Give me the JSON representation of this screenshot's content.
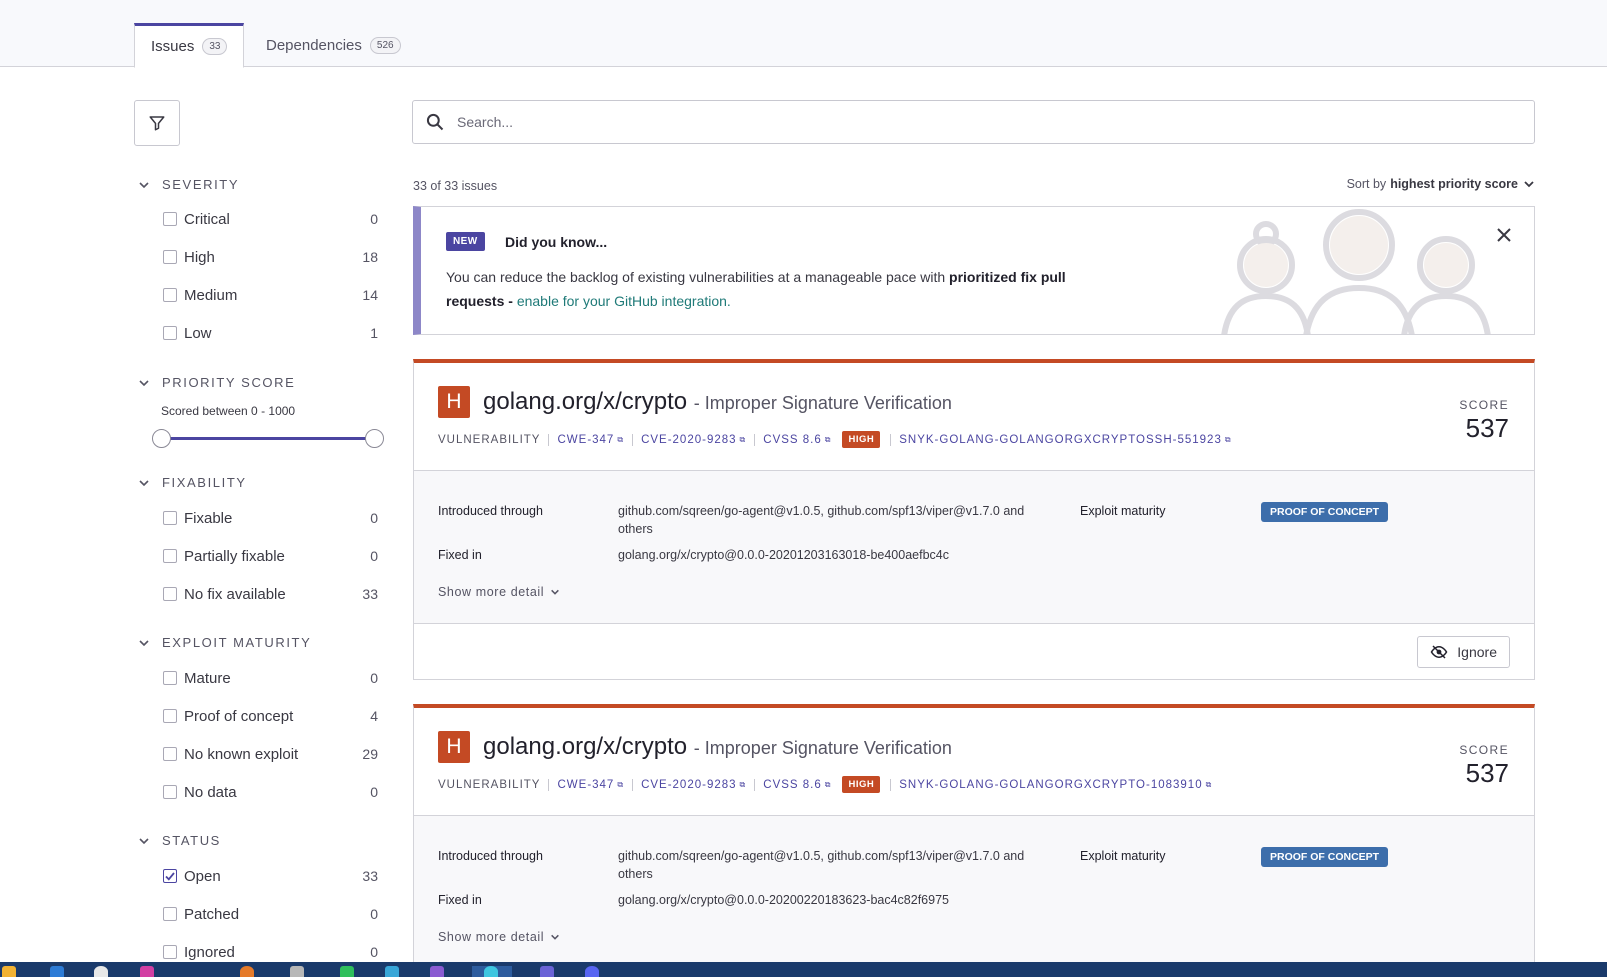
{
  "tabs": [
    {
      "label": "Issues",
      "count": "33"
    },
    {
      "label": "Dependencies",
      "count": "526"
    }
  ],
  "filters": {
    "severity": {
      "title": "SEVERITY",
      "items": [
        {
          "label": "Critical",
          "count": "0"
        },
        {
          "label": "High",
          "count": "18"
        },
        {
          "label": "Medium",
          "count": "14"
        },
        {
          "label": "Low",
          "count": "1"
        }
      ]
    },
    "priority": {
      "title": "PRIORITY SCORE",
      "range_label": "Scored between 0 - 1000",
      "range_min": 0,
      "range_max": 1000
    },
    "fixability": {
      "title": "FIXABILITY",
      "items": [
        {
          "label": "Fixable",
          "count": "0"
        },
        {
          "label": "Partially fixable",
          "count": "0"
        },
        {
          "label": "No fix available",
          "count": "33"
        }
      ]
    },
    "exploit": {
      "title": "EXPLOIT MATURITY",
      "items": [
        {
          "label": "Mature",
          "count": "0"
        },
        {
          "label": "Proof of concept",
          "count": "4"
        },
        {
          "label": "No known exploit",
          "count": "29"
        },
        {
          "label": "No data",
          "count": "0"
        }
      ]
    },
    "status": {
      "title": "STATUS",
      "items": [
        {
          "label": "Open",
          "count": "33",
          "checked": true
        },
        {
          "label": "Patched",
          "count": "0"
        },
        {
          "label": "Ignored",
          "count": "0"
        }
      ]
    }
  },
  "search": {
    "placeholder": "Search..."
  },
  "summary": "33 of 33 issues",
  "sort": {
    "prefix": "Sort by",
    "value": "highest priority score"
  },
  "banner": {
    "badge": "NEW",
    "title": "Did you know...",
    "text_before": "You can reduce the backlog of existing vulnerabilities at a manageable pace with ",
    "text_bold": "prioritized fix pull requests - ",
    "link": "enable for your GitHub integration."
  },
  "issues": [
    {
      "severity_letter": "H",
      "package": "golang.org/x/crypto",
      "title": "- Improper Signature Verification",
      "type": "VULNERABILITY",
      "cwe": "CWE-347",
      "cve": "CVE-2020-9283",
      "cvss": "CVSS 8.6",
      "severity": "HIGH",
      "snyk_id": "SNYK-GOLANG-GOLANGORGXCRYPTOSSH-551923",
      "score_label": "SCORE",
      "score": "537",
      "introduced_label": "Introduced through",
      "introduced": "github.com/sqreen/go-agent@v1.0.5, github.com/spf13/viper@v1.7.0 and others",
      "fixed_label": "Fixed in",
      "fixed": "golang.org/x/crypto@0.0.0-20201203163018-be400aefbc4c",
      "exploit_label": "Exploit maturity",
      "exploit": "PROOF OF CONCEPT",
      "more": "Show more detail",
      "ignore": "Ignore"
    },
    {
      "severity_letter": "H",
      "package": "golang.org/x/crypto",
      "title": "- Improper Signature Verification",
      "type": "VULNERABILITY",
      "cwe": "CWE-347",
      "cve": "CVE-2020-9283",
      "cvss": "CVSS 8.6",
      "severity": "HIGH",
      "snyk_id": "SNYK-GOLANG-GOLANGORGXCRYPTO-1083910",
      "score_label": "SCORE",
      "score": "537",
      "introduced_label": "Introduced through",
      "introduced": "github.com/sqreen/go-agent@v1.0.5, github.com/spf13/viper@v1.7.0 and others",
      "fixed_label": "Fixed in",
      "fixed": "golang.org/x/crypto@0.0.0-20200220183623-bac4c82f6975",
      "exploit_label": "Exploit maturity",
      "exploit": "PROOF OF CONCEPT",
      "more": "Show more detail"
    }
  ],
  "colors": {
    "accent": "#4b45a1",
    "high": "#c44a24",
    "poc": "#3d6eab",
    "link": "#1f7a78"
  }
}
